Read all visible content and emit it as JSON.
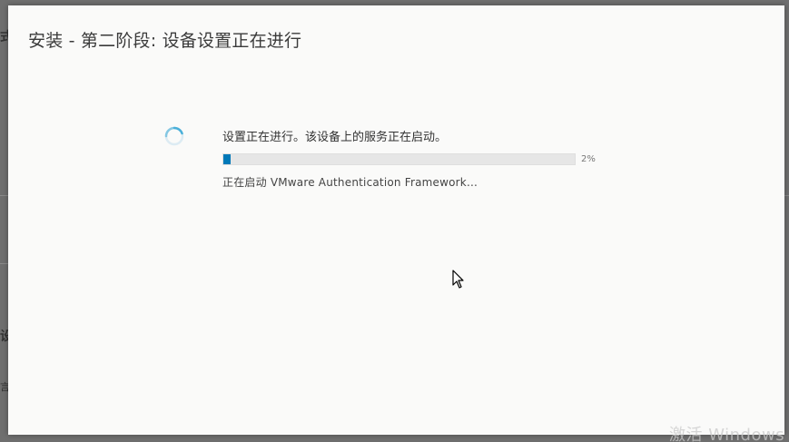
{
  "background": {
    "fragments": [
      "式",
      "设",
      "言"
    ]
  },
  "dialog": {
    "title": "安装 - 第二阶段: 设备设置正在进行",
    "status_message": "设置正在进行。该设备上的服务正在启动。",
    "progress_percent": 2,
    "progress_label": "2%",
    "sub_status": "正在启动 VMware Authentication Framework..."
  },
  "os": {
    "activation_watermark": "激活 Windows"
  },
  "colors": {
    "accent": "#0079b8",
    "spinner": "#49afd9",
    "track": "#e6e6e6"
  },
  "icons": {
    "spinner": "loading-spinner-icon",
    "cursor": "mouse-pointer-icon"
  }
}
